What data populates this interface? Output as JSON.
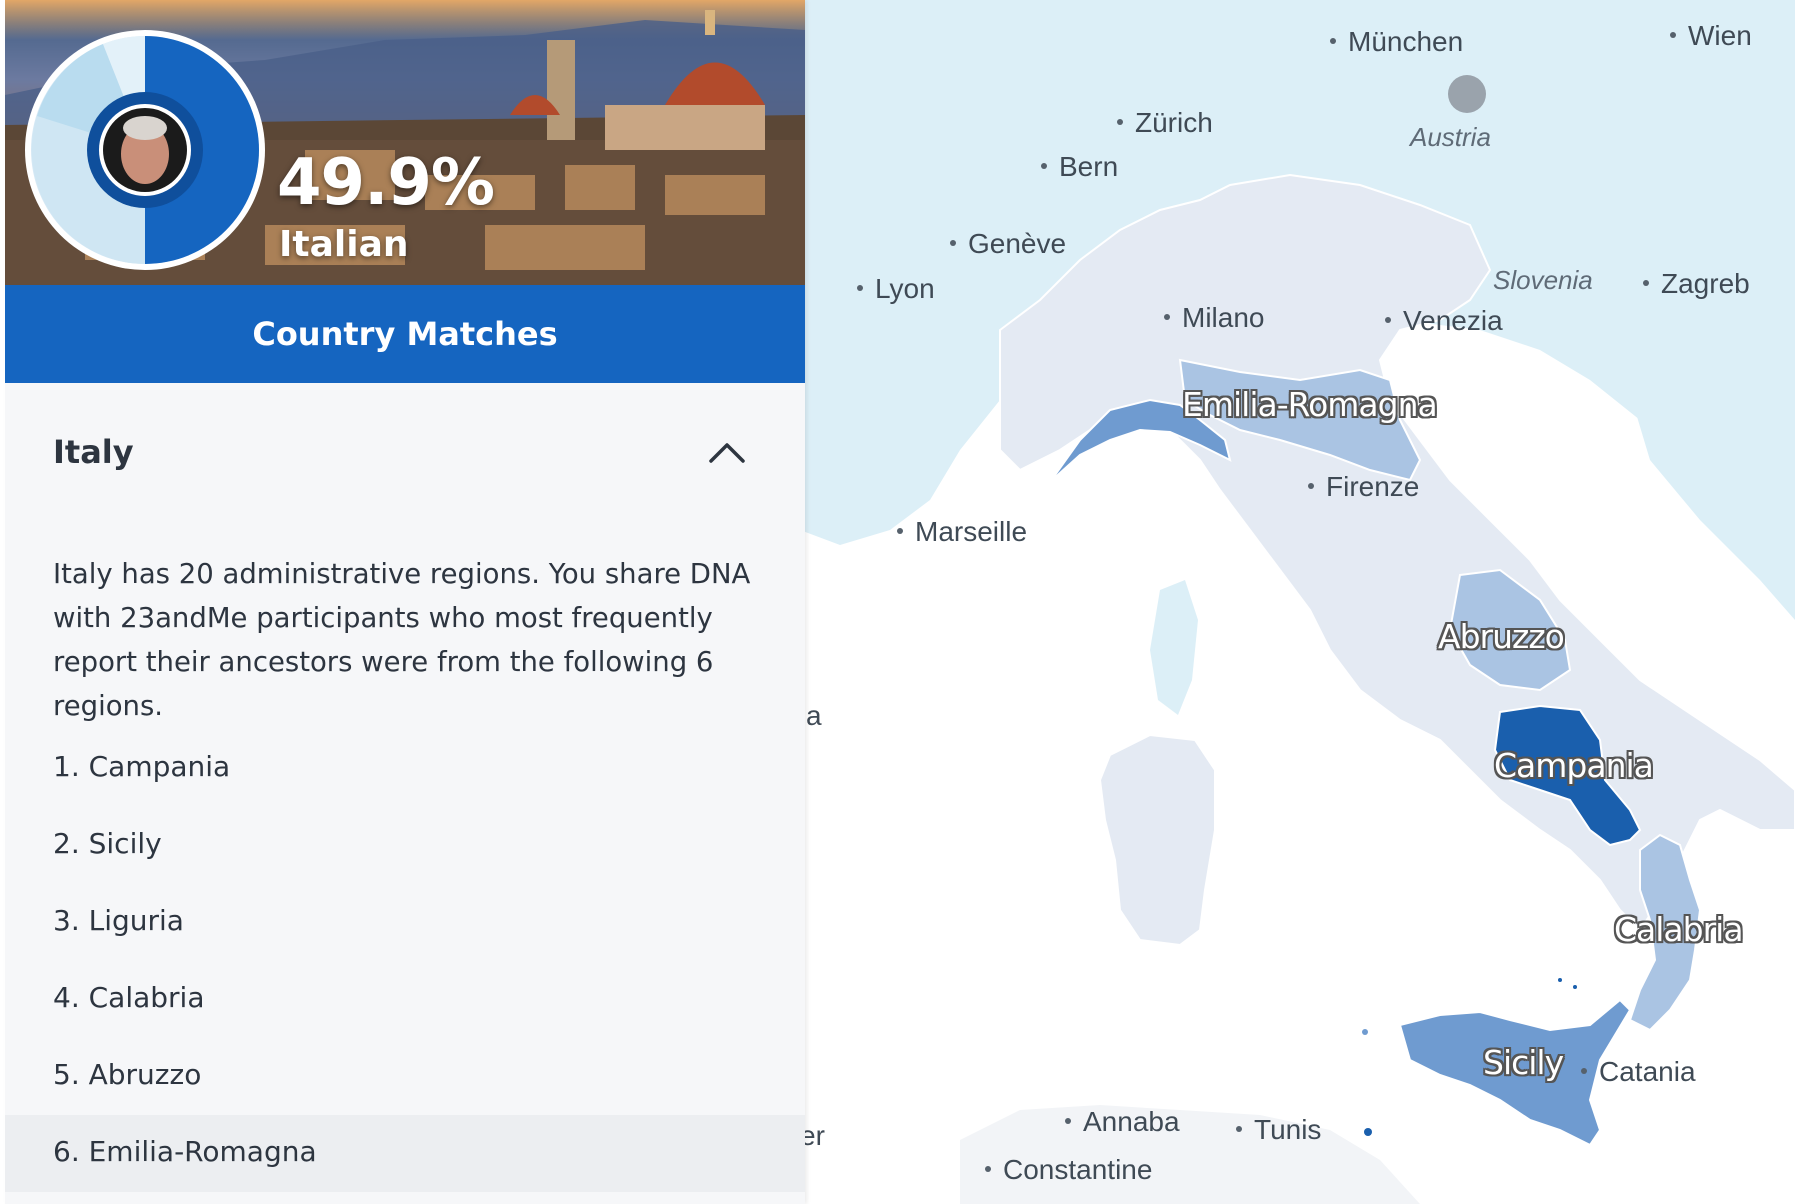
{
  "header": {
    "percentage": "49.9%",
    "ancestry_label": "Italian",
    "section_title": "Country Matches"
  },
  "country": {
    "name": "Italy",
    "description": "Italy has 20 administrative regions. You share DNA with 23andMe participants who most frequently report their ancestors were from the following 6 regions.",
    "regions": [
      {
        "label": "1. Campania"
      },
      {
        "label": "2. Sicily"
      },
      {
        "label": "3. Liguria"
      },
      {
        "label": "4. Calabria"
      },
      {
        "label": "5. Abruzzo"
      },
      {
        "label": "6. Emilia-Romagna"
      }
    ]
  },
  "map": {
    "cities": [
      "München",
      "Wien",
      "Zürich",
      "Bern",
      "Genève",
      "Lyon",
      "Milano",
      "Venezia",
      "Zagreb",
      "Firenze",
      "Marseille",
      "Catania",
      "Annaba",
      "Tunis",
      "Constantine"
    ],
    "countries": [
      "Austria",
      "Slovenia"
    ],
    "region_labels": [
      "Emilia-Romagna",
      "Abruzzo",
      "Campania",
      "Calabria",
      "Sicily"
    ],
    "partial_labels": [
      "a",
      "er"
    ]
  },
  "colors": {
    "brand_blue": "#1565c0",
    "italy_base": "#e4eaf3",
    "region_strong": "#1a5fad",
    "region_medium": "#6f9bd0",
    "region_light": "#aac4e3",
    "neighbor_land": "#dceff7"
  }
}
